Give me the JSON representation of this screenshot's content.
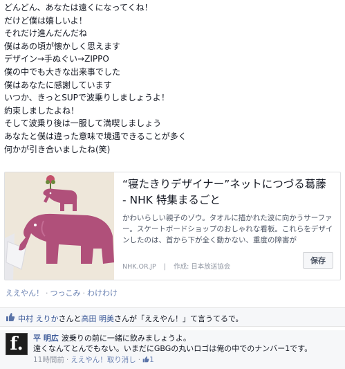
{
  "post": {
    "lines": [
      "どんどん、あなたは遠くになってくね！",
      "だけど僕は嬉しいよ！",
      "それだけ進んだんだね",
      "僕はあの頃が懐かしく思えます",
      "デザイン→手ぬぐい→ZIPPO",
      "僕の中でも大きな出来事でした",
      "僕はあなたに感謝しています",
      "いつか、きっとSUPで波乗りしましょうよ！",
      "約束しましたよね！",
      "そして波乗り後は一服して満喫しましょう",
      "あなたと僕は違った意味で境遇できることが多く",
      "何かが引き合いましたね(笑)"
    ]
  },
  "share": {
    "title": "“寝たきりデザイナー”ネットにつづる葛藤 - NHK 特集まるごと",
    "description": "かわいらしい親子のゾウ。タオルに描かれた波に向かうサーファー。スケートボードショップのおしゃれな看板。これらをデザインしたのは、首から下が全く動かない、重度の障害が",
    "domain": "NHK.OR.JP",
    "separator": "|",
    "author": "作成: 日本放送協会",
    "save_label": "保存"
  },
  "actions": {
    "like": "ええやん！",
    "comment": "つっこみ",
    "share": "わけわけ",
    "dot": "·"
  },
  "likes": {
    "name1": "中村 えりか",
    "joiner": "さんと",
    "name2": "高田 明美",
    "suffix": "さんが「ええやん！」て言うてるで。"
  },
  "comment": {
    "avatar_letter": "f.",
    "author": "平 明広",
    "text1": "波乗りの前に一緒に飲みましょうよ。",
    "text2": "遠くなんてとんでもない。いまだにGBGの丸いロゴは俺の中でのナンバー1です。",
    "time": "11時間前",
    "like": "ええやん！",
    "unlike": "取り消し",
    "like_count": "1",
    "dot": "·"
  },
  "colors": {
    "link": "#3b5998",
    "elephant": "#b0507a",
    "card_border": "#dddfe2"
  }
}
